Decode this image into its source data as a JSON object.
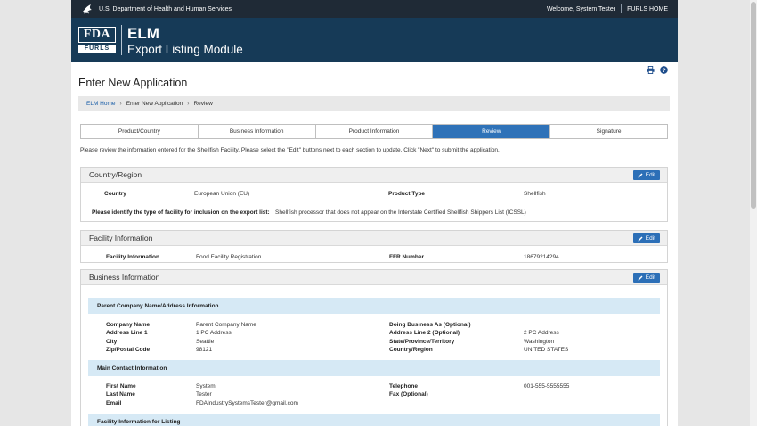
{
  "topbar": {
    "agency": "U.S. Department of Health and Human Services",
    "welcome": "Welcome, System Tester",
    "furls_home": "FURLS HOME"
  },
  "banner": {
    "logo_top": "FDA",
    "logo_bottom": "FURLS",
    "title": "ELM",
    "subtitle": "Export Listing Module"
  },
  "page_title": "Enter New Application",
  "breadcrumb": {
    "home": "ELM Home",
    "parent": "Enter New Application",
    "current": "Review"
  },
  "steps": [
    "Product/Country",
    "Business Information",
    "Product Information",
    "Review",
    "Signature"
  ],
  "active_step": "Review",
  "instructions": "Please review the information entered for the Shellfish Facility. Please select the \"Edit\" buttons next to each section to update. Click \"Next\" to submit the application.",
  "edit_label": "Edit",
  "country_region": {
    "title": "Country/Region",
    "country_label": "Country",
    "country_value": "European Union (EU)",
    "product_type_label": "Product Type",
    "product_type_value": "Shellfish",
    "facility_type_label": "Please identify the type of facility for inclusion on the export list:",
    "facility_type_value": "Shellfish processor that does not appear on the Interstate Certified Shellfish Shippers List (ICSSL)"
  },
  "facility_information": {
    "title": "Facility Information",
    "fi_label": "Facility Information",
    "fi_value": "Food Facility Registration",
    "ffr_label": "FFR Number",
    "ffr_value": "18679214294"
  },
  "business_information": {
    "title": "Business Information",
    "parent_company": {
      "heading": "Parent Company Name/Address Information",
      "company_name_label": "Company Name",
      "company_name_value": "Parent Company Name",
      "dba_label": "Doing Business As  (Optional)",
      "address1_label": "Address Line 1",
      "address1_value": "1 PC Address",
      "address2_label": "Address Line 2  (Optional)",
      "address2_value": "2 PC Address",
      "city_label": "City",
      "city_value": "Seattle",
      "state_label": "State/Province/Territory",
      "state_value": "Washington",
      "zip_label": "Zip/Postal Code",
      "zip_value": "98121",
      "country_label": "Country/Region",
      "country_value": "UNITED STATES"
    },
    "main_contact": {
      "heading": "Main Contact Information",
      "first_name_label": "First Name",
      "first_name_value": "System",
      "telephone_label": "Telephone",
      "telephone_value": "001-555-5555555",
      "last_name_label": "Last Name",
      "last_name_value": "Tester",
      "fax_label": "Fax  (Optional)",
      "email_label": "Email",
      "email_value": "FDAIndustrySystemsTester@gmail.com"
    },
    "facility_listing": {
      "heading": "Facility Information for Listing"
    }
  },
  "colors": {
    "topbar": "#1f2a36",
    "banner": "#163a57",
    "accent": "#2f72b8",
    "subhead": "#d6e9f5"
  }
}
